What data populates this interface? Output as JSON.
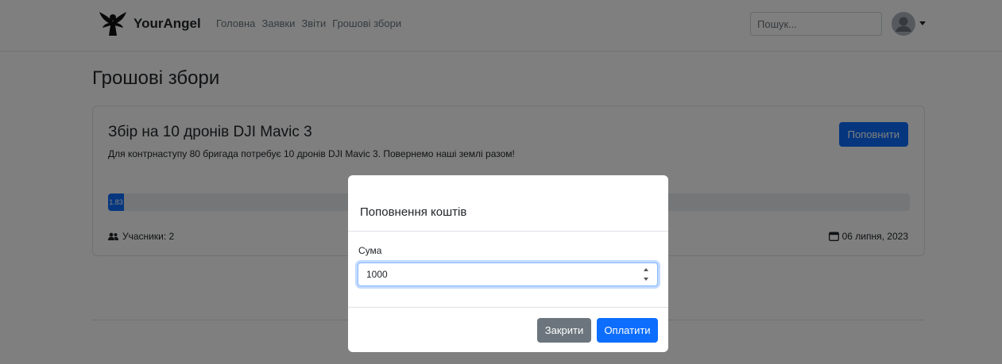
{
  "navbar": {
    "brand": "YourAngel",
    "links": [
      "Головна",
      "Заявки",
      "Звіти",
      "Грошові збори"
    ],
    "search_placeholder": "Пошук..."
  },
  "page": {
    "title": "Грошові збори"
  },
  "fundraiser": {
    "title": "Збір на 10 дронів DJI Mavic 3",
    "description": "Для контрнаступу 80 бригада потребує 10 дронів DJI Mavic 3. Повернемо наші землі разом!",
    "topup_label": "Поповнити",
    "progress_label": "1.83",
    "progress_percent": 1.83,
    "participants_label": "Учасники: 2",
    "date": "06 липня, 2023"
  },
  "modal": {
    "title": "Поповнення коштів",
    "amount_label": "Сума",
    "amount_value": "1000",
    "close_label": "Закрити",
    "pay_label": "Оплатити"
  },
  "colors": {
    "primary": "#0d6efd",
    "secondary": "#6c757d",
    "backdrop": "rgba(0,0,0,0.5)"
  },
  "icons": {
    "brand": "angel-icon",
    "participants": "users-icon",
    "date": "calendar-icon",
    "avatar": "user-avatar-icon"
  }
}
